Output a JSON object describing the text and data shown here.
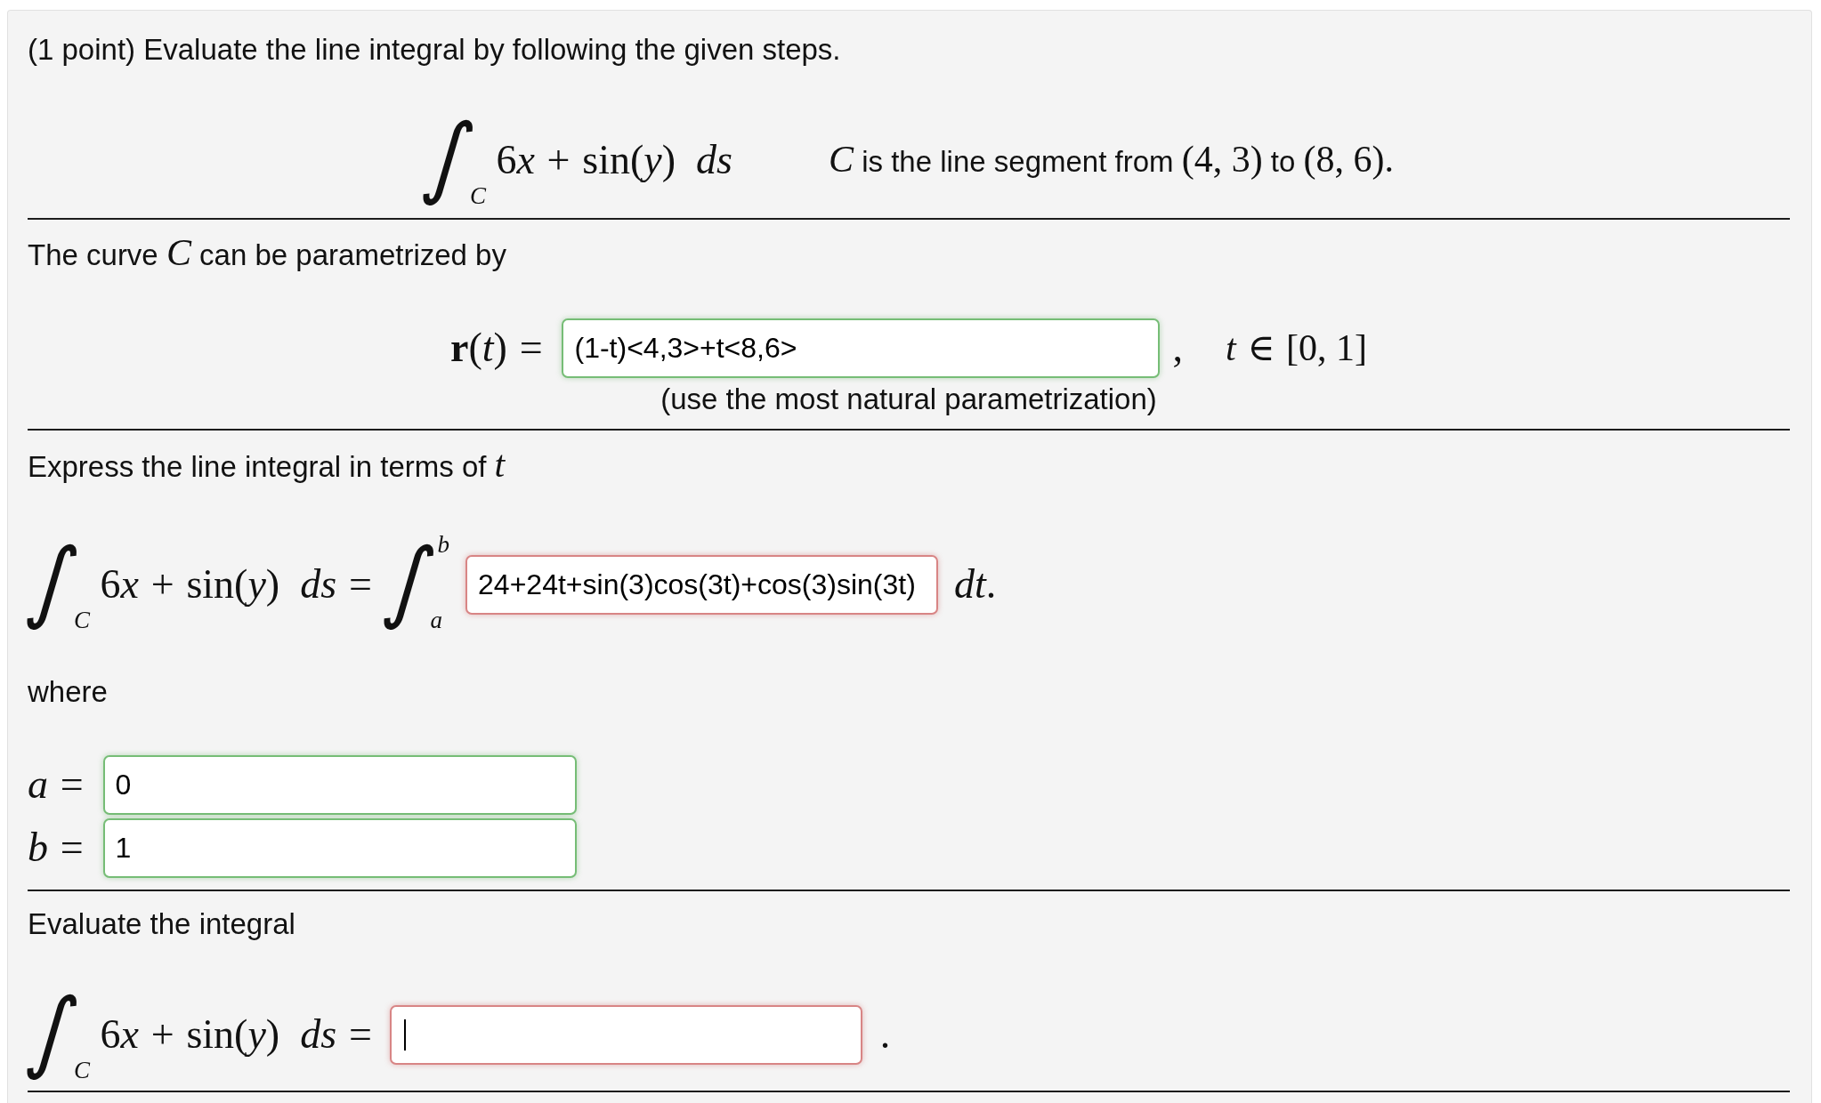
{
  "problem": {
    "intro": "(1 point) Evaluate the line integral by following the given steps.",
    "integral": {
      "sign": "∫",
      "lower": "C",
      "integrand": [
        {
          "kind": "math",
          "text": "6"
        },
        {
          "kind": "variable",
          "text": "x"
        },
        {
          "kind": "operator",
          "text": "+"
        },
        {
          "kind": "math",
          "text": "sin("
        },
        {
          "kind": "variable",
          "text": "y"
        },
        {
          "kind": "math",
          "text": ")"
        }
      ],
      "differential": "ds"
    },
    "curve": [
      {
        "kind": "variable",
        "text": "C"
      },
      {
        "kind": "text",
        "text": "is the line segment from"
      },
      {
        "kind": "math",
        "text": "(4, 3)"
      },
      {
        "kind": "text",
        "text": "to"
      },
      {
        "kind": "math",
        "text": "(8, 6)."
      }
    ]
  },
  "parametrization": {
    "heading": [
      {
        "kind": "text",
        "text": "The curve"
      },
      {
        "kind": "variable",
        "text": "C"
      },
      {
        "kind": "text",
        "text": "can be parametrized by"
      }
    ],
    "label": [
      {
        "kind": "bold",
        "text": "r"
      },
      {
        "kind": "math",
        "text": "("
      },
      {
        "kind": "variable",
        "text": "t"
      },
      {
        "kind": "math",
        "text": ")"
      },
      {
        "kind": "relation",
        "text": "="
      }
    ],
    "answer": {
      "value": "(1-t)<4,3>+t<8,6>",
      "correct": true
    },
    "after": ",",
    "domain": [
      {
        "kind": "variable",
        "text": "t"
      },
      {
        "kind": "relation",
        "text": "∈"
      },
      {
        "kind": "math",
        "text": "[0, 1]"
      }
    ],
    "hint": "(use the most natural parametrization)"
  },
  "in_terms_of_t": {
    "heading": [
      {
        "kind": "text",
        "text": "Express the line integral in terms of"
      },
      {
        "kind": "variable",
        "text": "t"
      }
    ],
    "integral": {
      "sign": "∫",
      "lower": "C",
      "integrand": [
        {
          "kind": "math",
          "text": "6"
        },
        {
          "kind": "variable",
          "text": "x"
        },
        {
          "kind": "operator",
          "text": "+"
        },
        {
          "kind": "math",
          "text": "sin("
        },
        {
          "kind": "variable",
          "text": "y"
        },
        {
          "kind": "math",
          "text": ")"
        }
      ],
      "differential": "ds"
    },
    "equals": "=",
    "bounded": {
      "sign": "∫",
      "lower": "a",
      "upper": "b"
    },
    "answer": {
      "value": "24+24t+sin(3)cos(3t)+cos(3)sin(3t)",
      "correct": false
    },
    "after": [
      {
        "kind": "variable",
        "text": "dt"
      },
      {
        "kind": "math",
        "text": "."
      }
    ],
    "where": "where",
    "bounds": [
      {
        "label": [
          {
            "kind": "variable",
            "text": "a"
          },
          {
            "kind": "relation",
            "text": "="
          }
        ],
        "answer": {
          "value": "0",
          "correct": true
        }
      },
      {
        "label": [
          {
            "kind": "variable",
            "text": "b"
          },
          {
            "kind": "relation",
            "text": "="
          }
        ],
        "answer": {
          "value": "1",
          "correct": true
        }
      }
    ]
  },
  "evaluation": {
    "heading": [
      {
        "kind": "text",
        "text": "Evaluate the integral"
      }
    ],
    "integral": {
      "sign": "∫",
      "lower": "C",
      "integrand": [
        {
          "kind": "math",
          "text": "6"
        },
        {
          "kind": "variable",
          "text": "x"
        },
        {
          "kind": "operator",
          "text": "+"
        },
        {
          "kind": "math",
          "text": "sin("
        },
        {
          "kind": "variable",
          "text": "y"
        },
        {
          "kind": "math",
          "text": ")"
        }
      ],
      "differential": "ds"
    },
    "equals": "=",
    "answer": {
      "correct": false,
      "focused": true
    },
    "after": "."
  }
}
